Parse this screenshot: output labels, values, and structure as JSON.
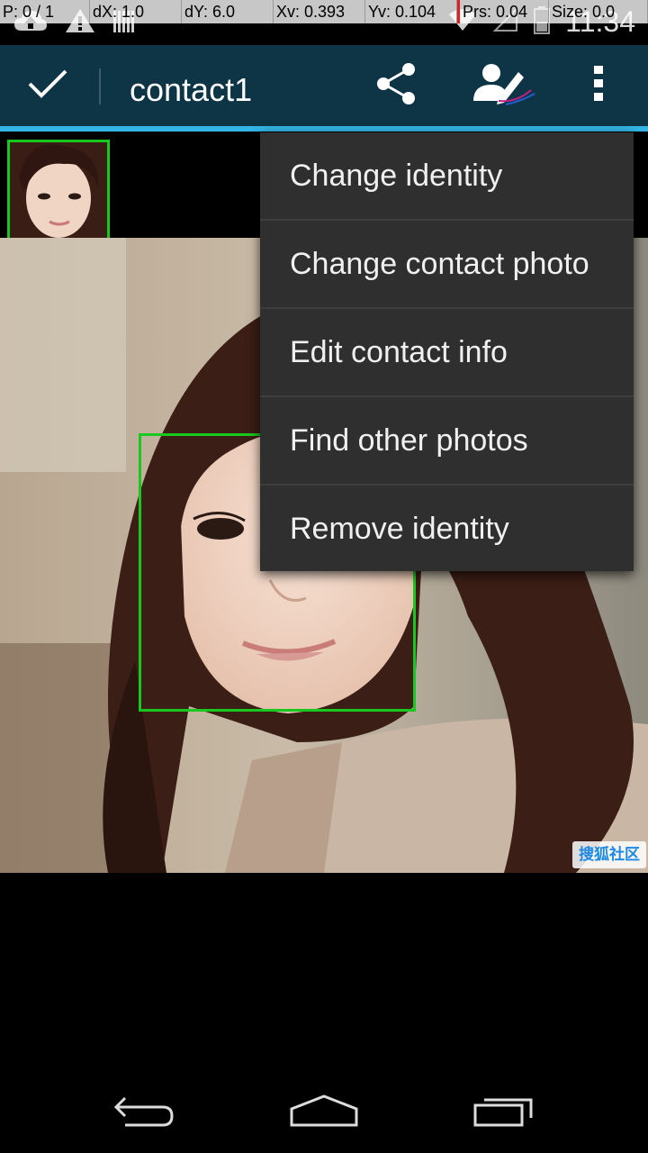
{
  "status_bar": {
    "time": "11:34",
    "icons_left": [
      "cloud-upload-icon",
      "warning-icon",
      "barcode-icon"
    ],
    "icons_right": [
      "wifi-icon",
      "signal-icon",
      "battery-icon"
    ]
  },
  "debug_overlay": {
    "cells": [
      "P: 0 / 1",
      "dX: 1.0",
      "dY: 6.0",
      "Xv: 0.393",
      "Yv: 0.104",
      "Prs: 0.04",
      "Size: 0.0"
    ]
  },
  "action_bar": {
    "title": "contact1",
    "icons": [
      "check-icon",
      "share-icon",
      "edit-contact-icon",
      "overflow-menu-icon"
    ]
  },
  "menu": {
    "items": [
      {
        "label": "Change identity"
      },
      {
        "label": "Change contact photo"
      },
      {
        "label": "Edit contact info"
      },
      {
        "label": "Find other photos"
      },
      {
        "label": "Remove identity"
      }
    ]
  },
  "photo": {
    "watermark": "搜狐社区"
  },
  "nav_bar": {
    "icons": [
      "back-icon",
      "home-icon",
      "recent-apps-icon"
    ]
  },
  "colors": {
    "action_bar": "#0d3546",
    "accent": "#33b5e5",
    "face_box": "#19c81e",
    "menu_bg": "#2f2f2f"
  }
}
